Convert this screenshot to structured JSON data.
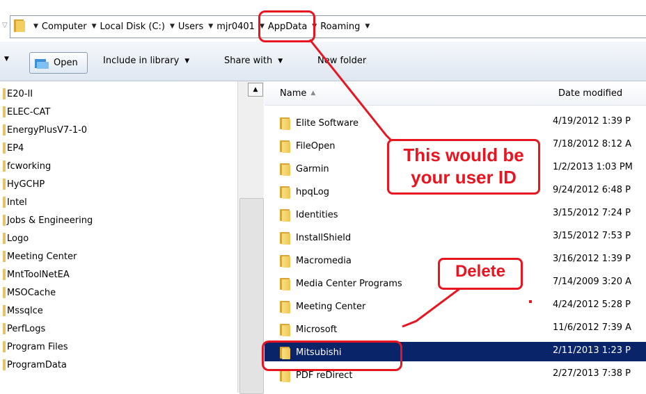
{
  "addressbar": {
    "crumbs": [
      "Computer",
      "Local Disk (C:)",
      "Users",
      "mjr0401",
      "AppData",
      "Roaming"
    ]
  },
  "toolbar": {
    "open_label": "Open",
    "include_label": "Include in library",
    "share_label": "Share with",
    "newfolder_label": "New folder"
  },
  "nav": {
    "items": [
      "E20-II",
      "ELEC-CAT",
      "EnergyPlusV7-1-0",
      "EP4",
      "fcworking",
      "HyGCHP",
      "Intel",
      "Jobs & Engineering",
      "Logo",
      "Meeting Center",
      "MntToolNetEA",
      "MSOCache",
      "Mssqlce",
      "PerfLogs",
      "Program Files",
      "ProgramData"
    ]
  },
  "files": {
    "name_header": "Name",
    "date_header": "Date modified",
    "rows": [
      {
        "name": "Elite Software",
        "date": "4/19/2012 1:39 P"
      },
      {
        "name": "FileOpen",
        "date": "7/18/2012 8:12 A"
      },
      {
        "name": "Garmin",
        "date": "1/2/2013 1:03 PM"
      },
      {
        "name": "hpqLog",
        "date": "9/24/2012 6:48 P"
      },
      {
        "name": "Identities",
        "date": "3/15/2012 7:24 P"
      },
      {
        "name": "InstallShield",
        "date": "3/15/2012 7:53 P"
      },
      {
        "name": "Macromedia",
        "date": "3/16/2012 1:39 P"
      },
      {
        "name": "Media Center Programs",
        "date": "7/14/2009 3:20 A"
      },
      {
        "name": "Meeting Center",
        "date": "4/24/2012 5:28 P"
      },
      {
        "name": "Microsoft",
        "date": "11/6/2012 7:39 A"
      },
      {
        "name": "Mitsubishi",
        "date": "2/11/2013 1:23 P"
      },
      {
        "name": "PDF reDirect",
        "date": "2/27/2013 7:38 P"
      }
    ]
  },
  "annotations": {
    "user_callout_line1": "This would be",
    "user_callout_line2": "your user ID",
    "delete_callout": "Delete",
    "color": "#e8141f"
  },
  "selection_color": "#0a246a"
}
